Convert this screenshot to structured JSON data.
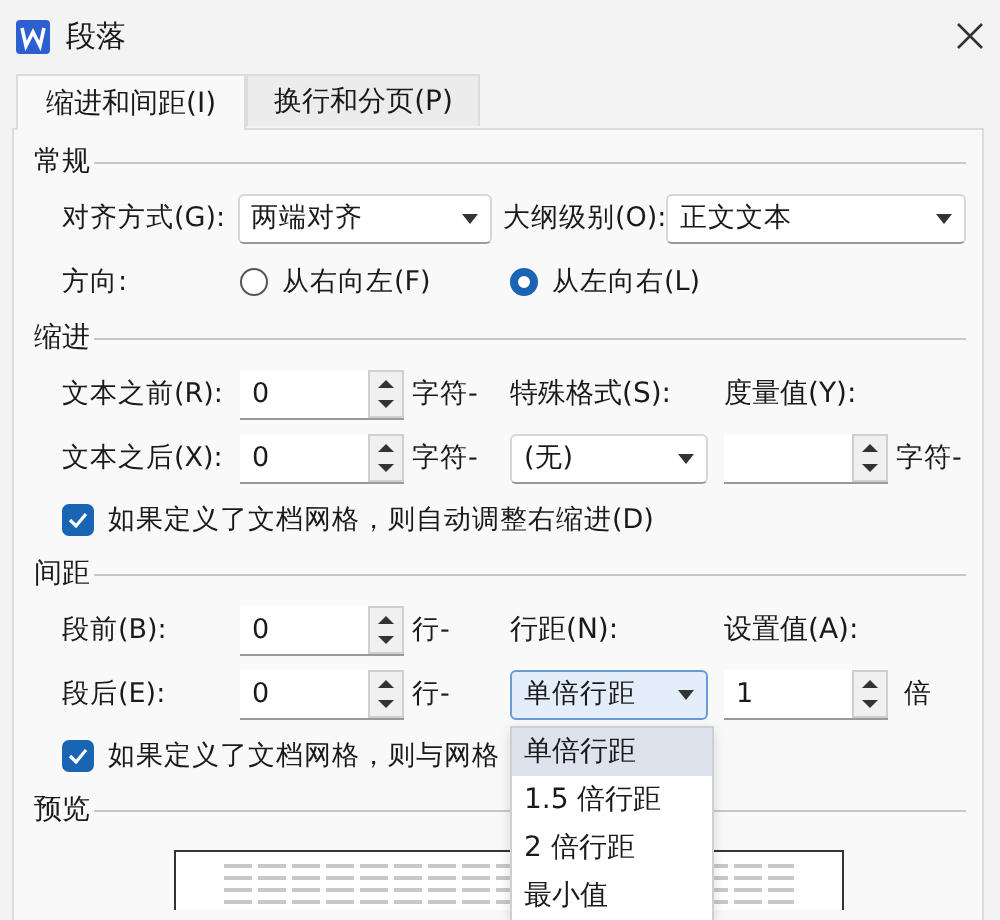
{
  "window": {
    "title": "段落"
  },
  "tabs": [
    {
      "label": "缩进和间距(I)",
      "selected": true
    },
    {
      "label": "换行和分页(P)",
      "selected": false
    }
  ],
  "general": {
    "title": "常规",
    "alignment": {
      "label": "对齐方式(G):",
      "value": "两端对齐"
    },
    "outline_level": {
      "label": "大纲级别(O):",
      "value": "正文文本"
    },
    "direction": {
      "label": "方向:",
      "options": [
        {
          "label": "从右向左(F)",
          "selected": false
        },
        {
          "label": "从左向右(L)",
          "selected": true
        }
      ]
    }
  },
  "indent": {
    "title": "缩进",
    "before": {
      "label": "文本之前(R):",
      "value": "0",
      "unit": "字符-"
    },
    "after": {
      "label": "文本之后(X):",
      "value": "0",
      "unit": "字符-"
    },
    "special_format": {
      "label": "特殊格式(S):",
      "value": "(无)"
    },
    "measure": {
      "label": "度量值(Y):",
      "unit": "字符-"
    },
    "auto_adjust": {
      "label": "如果定义了文档网格，则自动调整右缩进(D)",
      "checked": true
    }
  },
  "spacing": {
    "title": "间距",
    "before": {
      "label": "段前(B):",
      "value": "0",
      "unit": "行-"
    },
    "after": {
      "label": "段后(E):",
      "value": "0",
      "unit": "行-"
    },
    "line_spacing": {
      "label": "行距(N):",
      "value": "单倍行距",
      "expanded": true,
      "options": [
        {
          "label": "单倍行距",
          "selected": true
        },
        {
          "label": "1.5 倍行距",
          "selected": false
        },
        {
          "label": "2 倍行距",
          "selected": false
        },
        {
          "label": "最小值",
          "selected": false
        }
      ]
    },
    "set_value": {
      "label": "设置值(A):",
      "value": "1",
      "unit": "倍"
    },
    "snap_grid": {
      "label": "如果定义了文档网格，则与网格",
      "checked": true
    }
  },
  "preview": {
    "title": "预览"
  }
}
